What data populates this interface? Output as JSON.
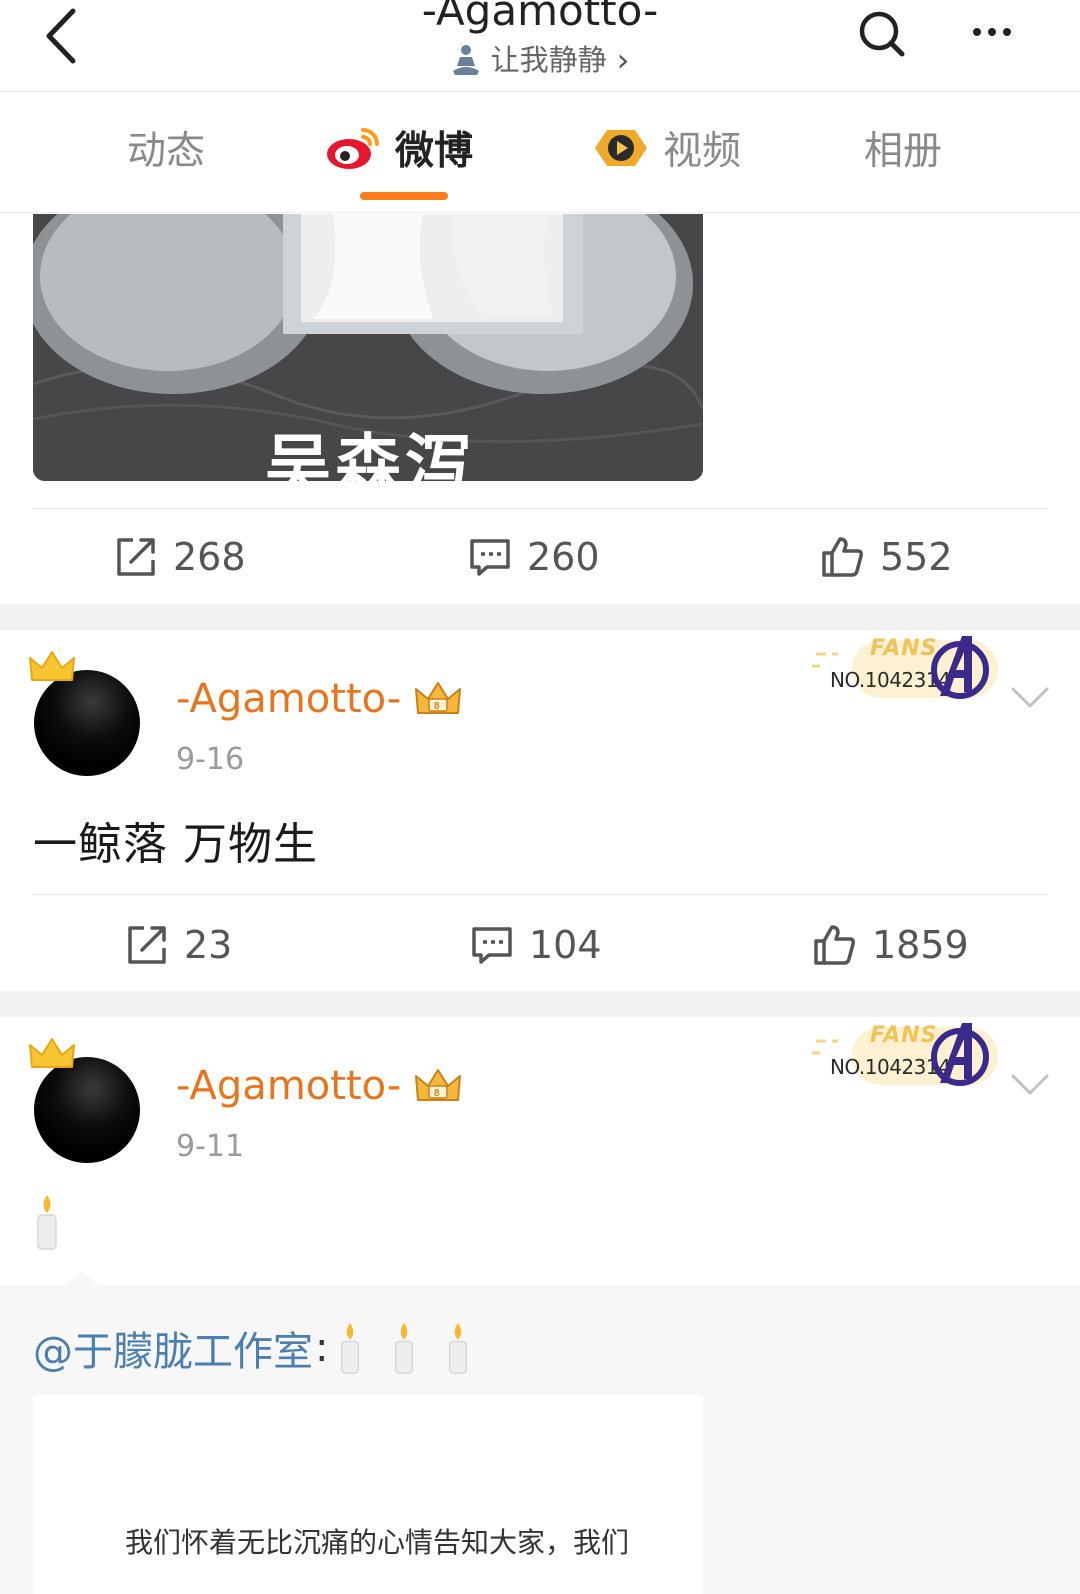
{
  "header": {
    "title": "-Agamotto-",
    "status": "让我静静",
    "status_chevron": "›"
  },
  "tabs": [
    {
      "label": "动态",
      "active": false
    },
    {
      "label": "微博",
      "active": true
    },
    {
      "label": "视频",
      "active": false
    },
    {
      "label": "相册",
      "active": false
    }
  ],
  "posts": [
    {
      "media_text": "吴森泻",
      "stats": {
        "reposts": "268",
        "comments": "260",
        "likes": "552"
      }
    },
    {
      "author": "-Agamotto-",
      "date": "9-16",
      "badge": {
        "label": "FANS",
        "number": "NO.1042314"
      },
      "text": "一鲸落 万物生",
      "stats": {
        "reposts": "23",
        "comments": "104",
        "likes": "1859"
      }
    },
    {
      "author": "-Agamotto-",
      "date": "9-11",
      "badge": {
        "label": "FANS",
        "number": "NO.1042314"
      },
      "text_emoji": "candle",
      "repost": {
        "author": "@于朦胧工作室",
        "separator": ":",
        "emoji_count": 3,
        "excerpt": "我们怀着无比沉痛的心情告知大家，我们"
      }
    }
  ],
  "colors": {
    "accent": "#ff7d1f",
    "username": "#e8741b",
    "mention": "#4a7fb0",
    "feed_gap": "#f2f2f2"
  },
  "icons": [
    "back-arrow-icon",
    "search-icon",
    "more-icon",
    "meditation-icon",
    "weibo-logo-icon",
    "video-play-icon",
    "repost-icon",
    "comment-icon",
    "like-icon",
    "crown-icon",
    "vip-crown-icon",
    "avengers-icon",
    "chevron-down-icon",
    "candle-icon"
  ]
}
